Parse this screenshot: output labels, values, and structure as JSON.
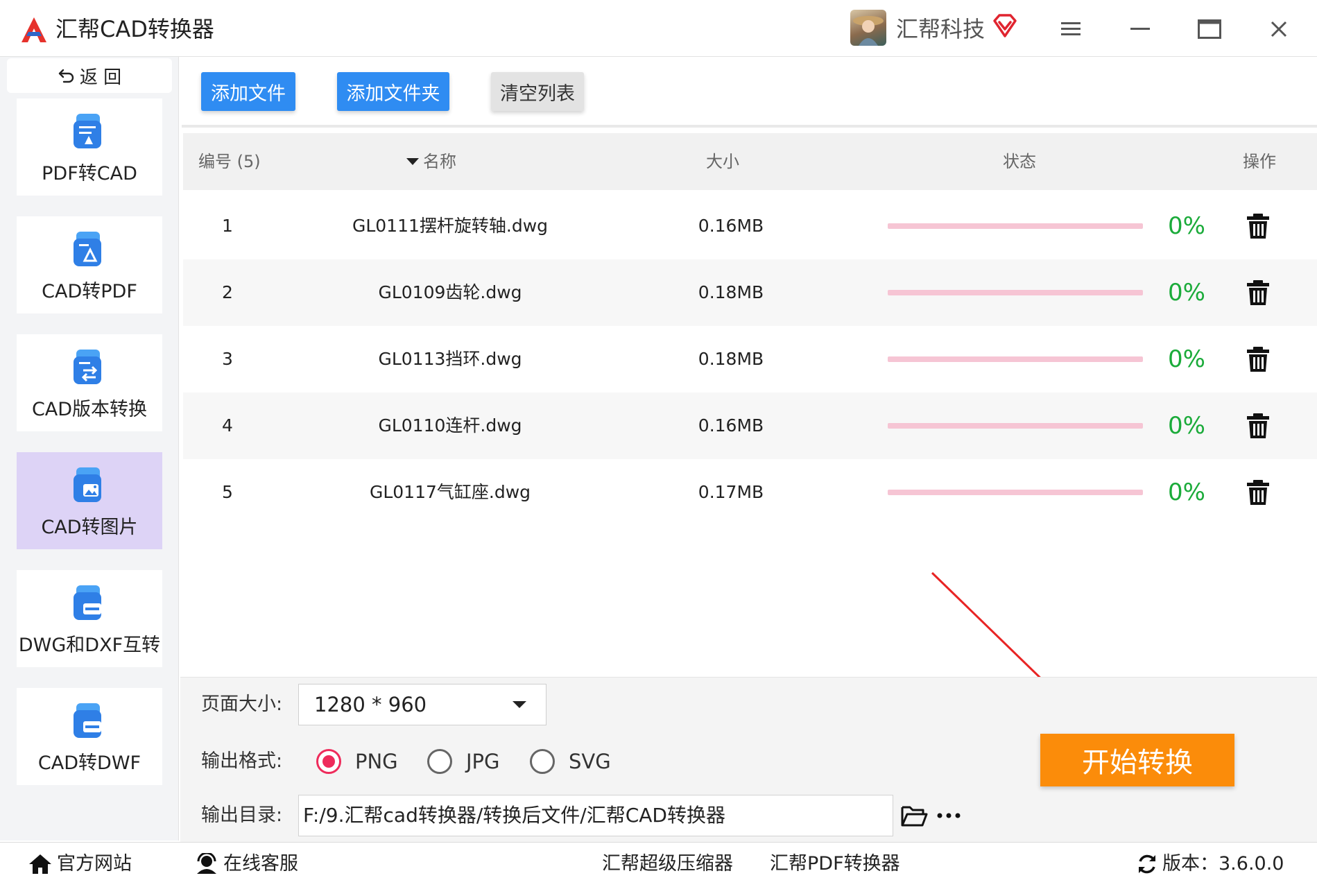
{
  "app": {
    "title": "汇帮CAD转换器",
    "user_name": "汇帮科技",
    "brand_color": "#2f8cf2"
  },
  "sidebar": {
    "back_label": "返 回",
    "items": [
      {
        "label": "PDF转CAD",
        "icon": "pdf-to-cad-icon",
        "active": false
      },
      {
        "label": "CAD转PDF",
        "icon": "cad-to-pdf-icon",
        "active": false
      },
      {
        "label": "CAD版本转换",
        "icon": "cad-version-convert-icon",
        "active": false
      },
      {
        "label": "CAD转图片",
        "icon": "cad-to-image-icon",
        "active": true
      },
      {
        "label": "DWG和DXF互转",
        "icon": "dwg-dxf-convert-icon",
        "active": false
      },
      {
        "label": "CAD转DWF",
        "icon": "cad-to-dwf-icon",
        "active": false
      }
    ]
  },
  "toolbar": {
    "add_file": "添加文件",
    "add_folder": "添加文件夹",
    "clear_list": "清空列表"
  },
  "table": {
    "headers": {
      "num": "编号 (5)",
      "name": "名称",
      "size": "大小",
      "status": "状态",
      "action": "操作"
    },
    "rows": [
      {
        "num": "1",
        "name": "GL0111摆杆旋转轴.dwg",
        "size": "0.16MB",
        "progress": 0,
        "percent": "0%"
      },
      {
        "num": "2",
        "name": "GL0109齿轮.dwg",
        "size": "0.18MB",
        "progress": 0,
        "percent": "0%"
      },
      {
        "num": "3",
        "name": "GL0113挡环.dwg",
        "size": "0.18MB",
        "progress": 0,
        "percent": "0%"
      },
      {
        "num": "4",
        "name": "GL0110连杆.dwg",
        "size": "0.16MB",
        "progress": 0,
        "percent": "0%"
      },
      {
        "num": "5",
        "name": "GL0117气缸座.dwg",
        "size": "0.17MB",
        "progress": 0,
        "percent": "0%"
      }
    ]
  },
  "options": {
    "page_size_label": "页面大小:",
    "page_size_value": "1280 * 960",
    "format_label": "输出格式:",
    "formats": [
      "PNG",
      "JPG",
      "SVG"
    ],
    "selected_format": "PNG",
    "output_dir_label": "输出目录:",
    "output_dir_value": "F:/9.汇帮cad转换器/转换后文件/汇帮CAD转换器",
    "start_button": "开始转换"
  },
  "footer": {
    "website": "官方网站",
    "support": "在线客服",
    "link1": "汇帮超级压缩器",
    "link2": "汇帮PDF转换器",
    "version": "版本：3.6.0.0"
  },
  "colors": {
    "accent_orange": "#fb8c0a",
    "progress_track": "#f6c5d4",
    "percent_green": "#1bab3a",
    "radio_selected": "#ee2b5b",
    "active_sidebar": "#ddd3f6",
    "annotation_arrow": "#e82424"
  }
}
